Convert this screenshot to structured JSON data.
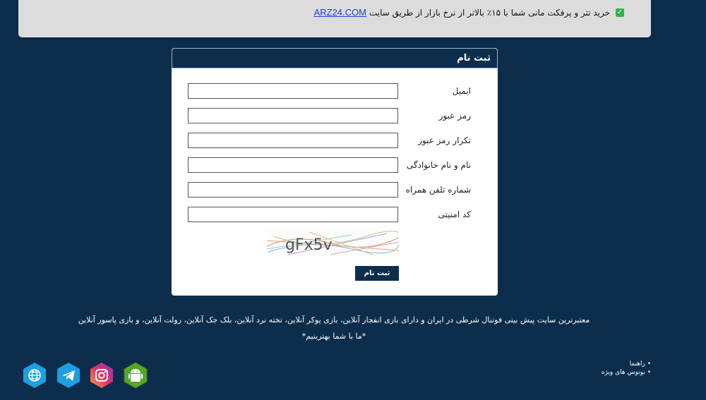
{
  "notice": {
    "text": "خرید تتر و پرفکت مانی شما با ۱۵٪ بالاتر از نرخ بازار از طریق سایت",
    "link": "ARZ24.COM"
  },
  "form": {
    "title": "ثبت نام",
    "fields": [
      {
        "label": "ایمیل",
        "value": ""
      },
      {
        "label": "رمز عبور",
        "value": ""
      },
      {
        "label": "تکرار رمز عبور",
        "value": ""
      },
      {
        "label": "نام و نام خانوادگی",
        "value": ""
      },
      {
        "label": "شماره تلفن همراه",
        "value": ""
      },
      {
        "label": "کد امنیتی",
        "value": ""
      }
    ],
    "captcha_text": "gFx5v",
    "submit_label": "ثبت نام"
  },
  "footer": {
    "description": "معتبرترین سایت پیش بینی فوتبال شرطی در ایران و دارای بازی انفجار آنلاین، بازی پوکر آنلاین، تخته نرد آنلاین، بلک جک آنلاین، رولت آنلاین، و بازی پاسور آنلاین",
    "slogan": "*ما با شما بهترینیم*",
    "links": [
      "راهنما",
      "بونوس های ویژه"
    ]
  },
  "social": [
    {
      "icon": "android-icon",
      "color": "#58a52b"
    },
    {
      "icon": "instagram-icon",
      "color": "#d6246e"
    },
    {
      "icon": "telegram-icon",
      "color": "#1d9fe0"
    },
    {
      "icon": "globe-icon",
      "color": "#1d9fe0"
    }
  ]
}
